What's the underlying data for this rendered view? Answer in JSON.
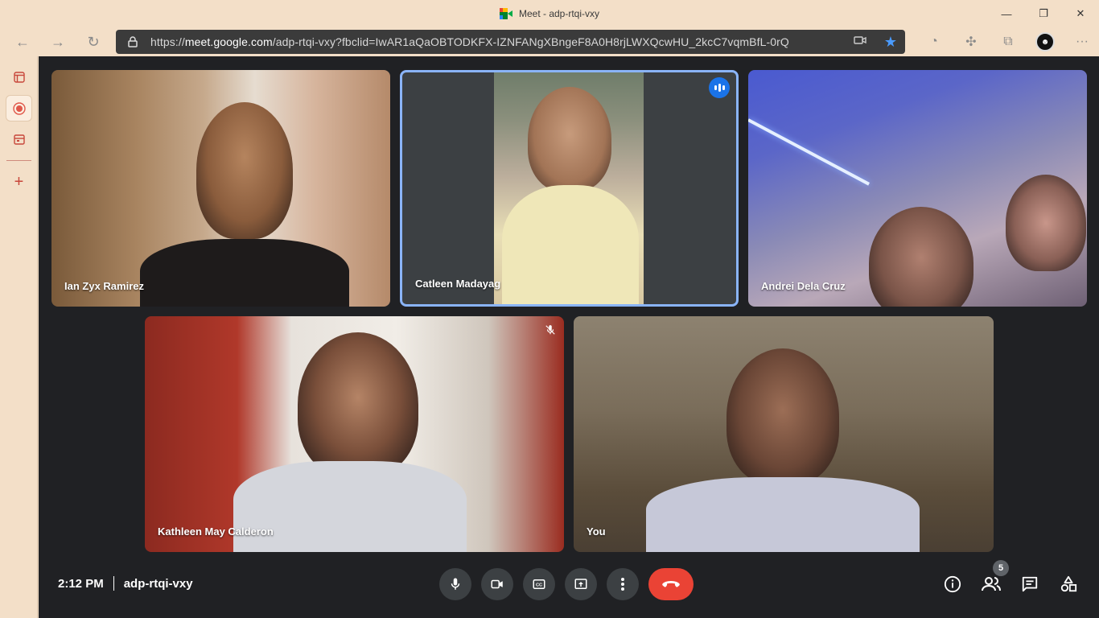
{
  "window": {
    "tab_title": "Meet - adp-rtqi-vxy"
  },
  "address_bar": {
    "url_prefix": "https://",
    "url_host": "meet.google.com",
    "url_path": "/adp-rtqi-vxy?fbclid=IwAR1aQaOBTODKFX-IZNFANgXBngeF8A0H8rjLWXQcwHU_2kcC7vqmBfL-0rQ"
  },
  "participants": [
    {
      "name": "Ian Zyx Ramirez"
    },
    {
      "name": "Catleen Madayag",
      "speaking": true
    },
    {
      "name": "Andrei Dela Cruz"
    },
    {
      "name": "Kathleen May Calderon",
      "muted": true
    },
    {
      "name": "You"
    }
  ],
  "bottom_bar": {
    "time": "2:12 PM",
    "meeting_code": "adp-rtqi-vxy",
    "participant_count": "5"
  },
  "colors": {
    "meet_background": "#202124",
    "control_button": "#3c4043",
    "end_call": "#ea4335",
    "active_speaker_border": "#8ab4f8",
    "speaking_indicator": "#1a73e8",
    "browser_chrome": "#f3dfc8"
  },
  "icons": {
    "browser": [
      "back-icon",
      "forward-icon",
      "refresh-icon",
      "lock-icon",
      "camera-icon",
      "star-icon",
      "extension-icon",
      "puzzle-icon",
      "collections-icon",
      "more-icon"
    ],
    "controls": [
      "mic-icon",
      "camera-icon",
      "captions-icon",
      "present-icon",
      "more-vert-icon",
      "end-call-icon"
    ],
    "side_controls": [
      "info-icon",
      "people-icon",
      "chat-icon",
      "activities-icon"
    ]
  }
}
